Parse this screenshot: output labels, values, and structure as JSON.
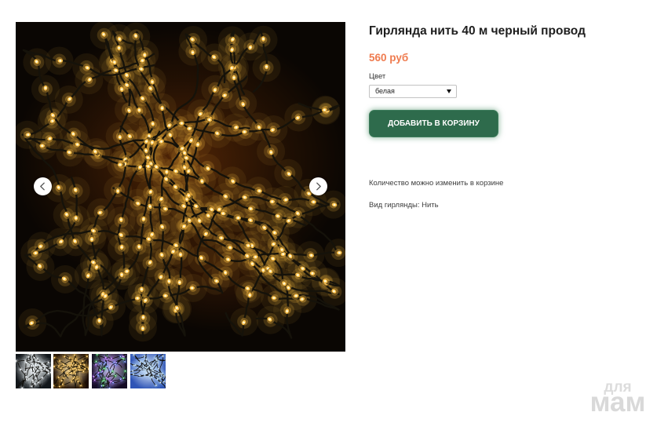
{
  "product": {
    "title": "Гирлянда нить 40 м черный провод",
    "price": "560 руб",
    "color_label": "Цвет",
    "color_select_value": "белая",
    "add_to_cart_label": "ДОБАВИТЬ В КОРЗИНУ",
    "quantity_note": "Количество можно изменить в корзине",
    "garland_type": "Вид гирлянды: Нить"
  },
  "gallery": {
    "prev_icon": "chevron-left-icon",
    "next_icon": "chevron-right-icon",
    "photo": {
      "light": "#ffc145",
      "core": "#fff4cf",
      "wire": "#15120a"
    },
    "thumbnails": [
      {
        "bg": "#12171b",
        "lights": [
          "#f2f8ff"
        ]
      },
      {
        "bg": "#1c0d03",
        "lights": [
          "#ffc24a"
        ]
      },
      {
        "bg": "#150c26",
        "lights": [
          "#b36bff",
          "#5be07a",
          "#6f8cff"
        ]
      },
      {
        "bg": "#2f55b6",
        "lights": [
          "#b8dcff"
        ]
      }
    ]
  },
  "select_icon": "dropdown-arrow-icon",
  "colors": {
    "price": "#ef7b4f",
    "button": "#2e6b4c",
    "button_text": "#ffffff",
    "title": "#1e1e1e"
  },
  "watermark": {
    "line1": "для",
    "line2": "мам"
  }
}
